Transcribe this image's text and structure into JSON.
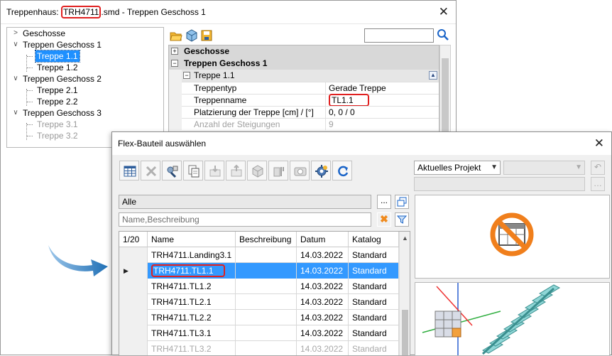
{
  "main_window": {
    "title_prefix": "Treppenhaus: ",
    "title_file": "TRH4711",
    "title_suffix": ".smd - Treppen Geschoss 1",
    "tree": [
      {
        "label": "Geschosse"
      },
      {
        "label": "Treppen Geschoss 1"
      },
      {
        "label": "Treppe 1.1"
      },
      {
        "label": "Treppe 1.2"
      },
      {
        "label": "Treppen Geschoss 2"
      },
      {
        "label": "Treppe 2.1"
      },
      {
        "label": "Treppe 2.2"
      },
      {
        "label": "Treppen Geschoss 3"
      },
      {
        "label": "Treppe 3.1"
      },
      {
        "label": "Treppe 3.2"
      }
    ],
    "properties": {
      "category_1": "Geschosse",
      "category_2": "Treppen Geschoss 1",
      "group": "Treppe 1.1",
      "rows": [
        {
          "key": "Treppentyp",
          "value": "Gerade Treppe"
        },
        {
          "key": "Treppenname",
          "value": "TL1.1"
        },
        {
          "key": "Platzierung der Treppe [cm] /  [°]",
          "value": "0, 0 / 0"
        },
        {
          "key": "Anzahl der Steigungen",
          "value": "9"
        }
      ]
    }
  },
  "dialog": {
    "title": "Flex-Bauteil auswählen",
    "project_combo": "Aktuelles Projekt",
    "filter_category": "Alle",
    "filter_placeholder": "Name,Beschreibung",
    "more_button": "...",
    "grid": {
      "counter": "1/20",
      "headers": [
        "Name",
        "Beschreibung",
        "Datum",
        "Katalog"
      ],
      "rows": [
        {
          "name": "TRH4711.Landing3.1",
          "desc": "",
          "date": "14.03.2022",
          "catalog": "Standard"
        },
        {
          "name": "TRH4711.TL1.1",
          "desc": "",
          "date": "14.03.2022",
          "catalog": "Standard"
        },
        {
          "name": "TRH4711.TL1.2",
          "desc": "",
          "date": "14.03.2022",
          "catalog": "Standard"
        },
        {
          "name": "TRH4711.TL2.1",
          "desc": "",
          "date": "14.03.2022",
          "catalog": "Standard"
        },
        {
          "name": "TRH4711.TL2.2",
          "desc": "",
          "date": "14.03.2022",
          "catalog": "Standard"
        },
        {
          "name": "TRH4711.TL3.1",
          "desc": "",
          "date": "14.03.2022",
          "catalog": "Standard"
        },
        {
          "name": "TRH4711.TL3.2",
          "desc": "",
          "date": "14.03.2022",
          "catalog": "Standard"
        }
      ]
    }
  },
  "colors": {
    "highlight_red": "#e02020",
    "selection_blue": "#3399ff",
    "arrow_blue": "#1f6fb5"
  }
}
